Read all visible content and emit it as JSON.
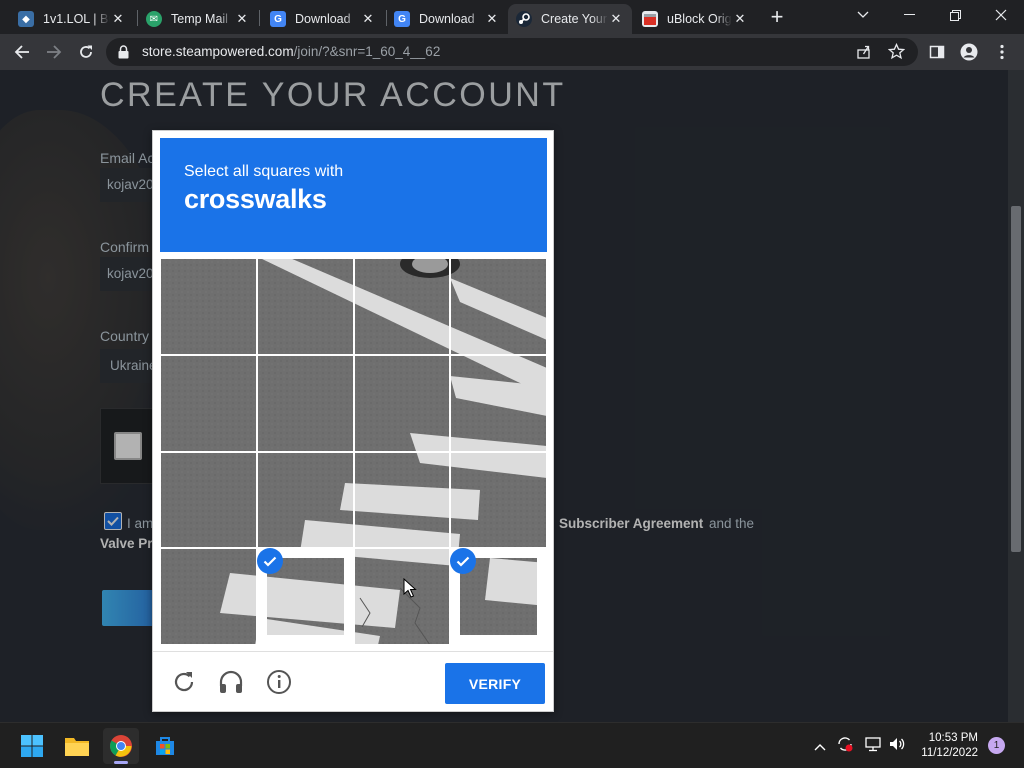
{
  "browser": {
    "tabs": [
      {
        "title": "1v1.LOL | Bu",
        "icon": "game-icon"
      },
      {
        "title": "Temp Mail",
        "icon": "tempmail-icon"
      },
      {
        "title": "Download",
        "icon": "google-docs-icon"
      },
      {
        "title": "Download",
        "icon": "google-docs-icon"
      },
      {
        "title": "Create Your",
        "icon": "steam-icon"
      },
      {
        "title": "uBlock Orig",
        "icon": "store-icon"
      }
    ],
    "url": {
      "host": "store.steampowered.com",
      "path": "/join/?&snr=1_60_4__62"
    }
  },
  "page": {
    "heading": "CREATE YOUR ACCOUNT",
    "email_label": "Email Ac",
    "email_value": "kojav20",
    "confirm_label": "Confirm",
    "confirm_value": "kojav20",
    "country_label": "Country",
    "country_value": "Ukraine",
    "agree_prefix": "I am",
    "subscriber_agreement": "Subscriber Agreement",
    "and_the": "and the",
    "valve_privacy": "Valve Pr"
  },
  "challenge": {
    "instruction": "Select all squares with",
    "target": "crosswalks",
    "grid_rows": 4,
    "grid_cols": 4,
    "selected_tiles": [
      13,
      15
    ],
    "verify_label": "VERIFY",
    "accent_color": "#1a73e8"
  },
  "taskbar": {
    "time": "10:53 PM",
    "date": "11/12/2022",
    "notification_count": "1"
  }
}
